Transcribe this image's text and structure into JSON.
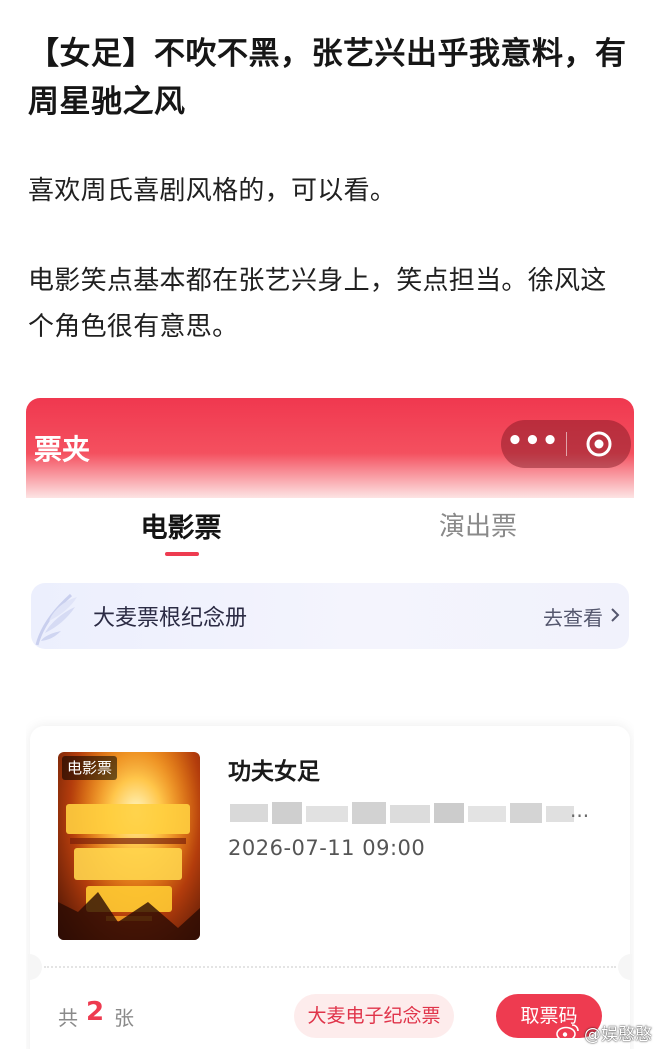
{
  "post": {
    "title": "【女足】不吹不黑，张艺兴出乎我意料，有周星驰之风",
    "paragraphs": [
      "喜欢周氏喜剧风格的，可以看。",
      "电影笑点基本都在张艺兴身上，笑点担当。徐风这个角色很有意思。"
    ]
  },
  "app": {
    "header_title": "票夹",
    "capsule_more": "•••",
    "tabs": [
      {
        "label": "电影票",
        "active": true
      },
      {
        "label": "演出票",
        "active": false
      }
    ],
    "memorial": {
      "label": "大麦票根纪念册",
      "link": "去查看"
    },
    "ticket": {
      "poster_tag": "电影票",
      "movie_title": "功夫女足",
      "venue_blurred": "",
      "ellipsis": "...",
      "show_time": "2026-07-11 09:00",
      "count_prefix": "共",
      "count": "2",
      "count_suffix": "张",
      "souvenir_button": "大麦电子纪念票",
      "code_button": "取票码"
    }
  },
  "watermark": {
    "icon": "weibo-icon",
    "text": "@娱憨憨"
  },
  "colors": {
    "brand_red": "#ee3b50",
    "header_gradient_top": "#f0384f",
    "memorial_bg": "#eceffd",
    "souvenir_bg": "#fdecec"
  }
}
